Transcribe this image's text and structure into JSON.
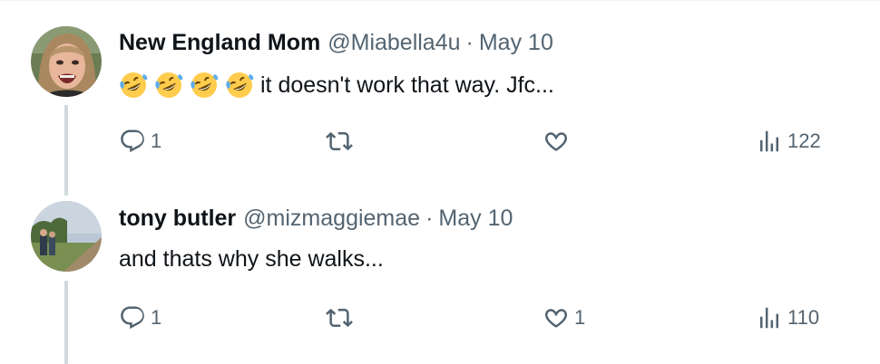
{
  "tweets": [
    {
      "display_name": "New England Mom",
      "handle": "@Miabella4u",
      "separator": "·",
      "date": "May 10",
      "emoji": [
        "rolling-on-floor-laughing",
        "rolling-on-floor-laughing",
        "rolling-on-floor-laughing",
        "rolling-on-floor-laughing"
      ],
      "text": "it doesn't work that way. Jfc...",
      "replies": "1",
      "retweets": "",
      "likes": "",
      "views": "122"
    },
    {
      "display_name": "tony butler",
      "handle": "@mizmaggiemae",
      "separator": "·",
      "date": "May 10",
      "text": "and thats why she walks...",
      "replies": "1",
      "retweets": "",
      "likes": "1",
      "views": "110"
    }
  ],
  "colors": {
    "text_primary": "#0f1419",
    "text_secondary": "#536471",
    "thread_line": "#cfd9de",
    "emoji_face": "#ffcc4d",
    "emoji_tears": "#5dadec"
  },
  "icons": {
    "reply": "speech-bubble-icon",
    "retweet": "retweet-arrows-icon",
    "like": "heart-outline-icon",
    "views": "bar-chart-icon"
  }
}
